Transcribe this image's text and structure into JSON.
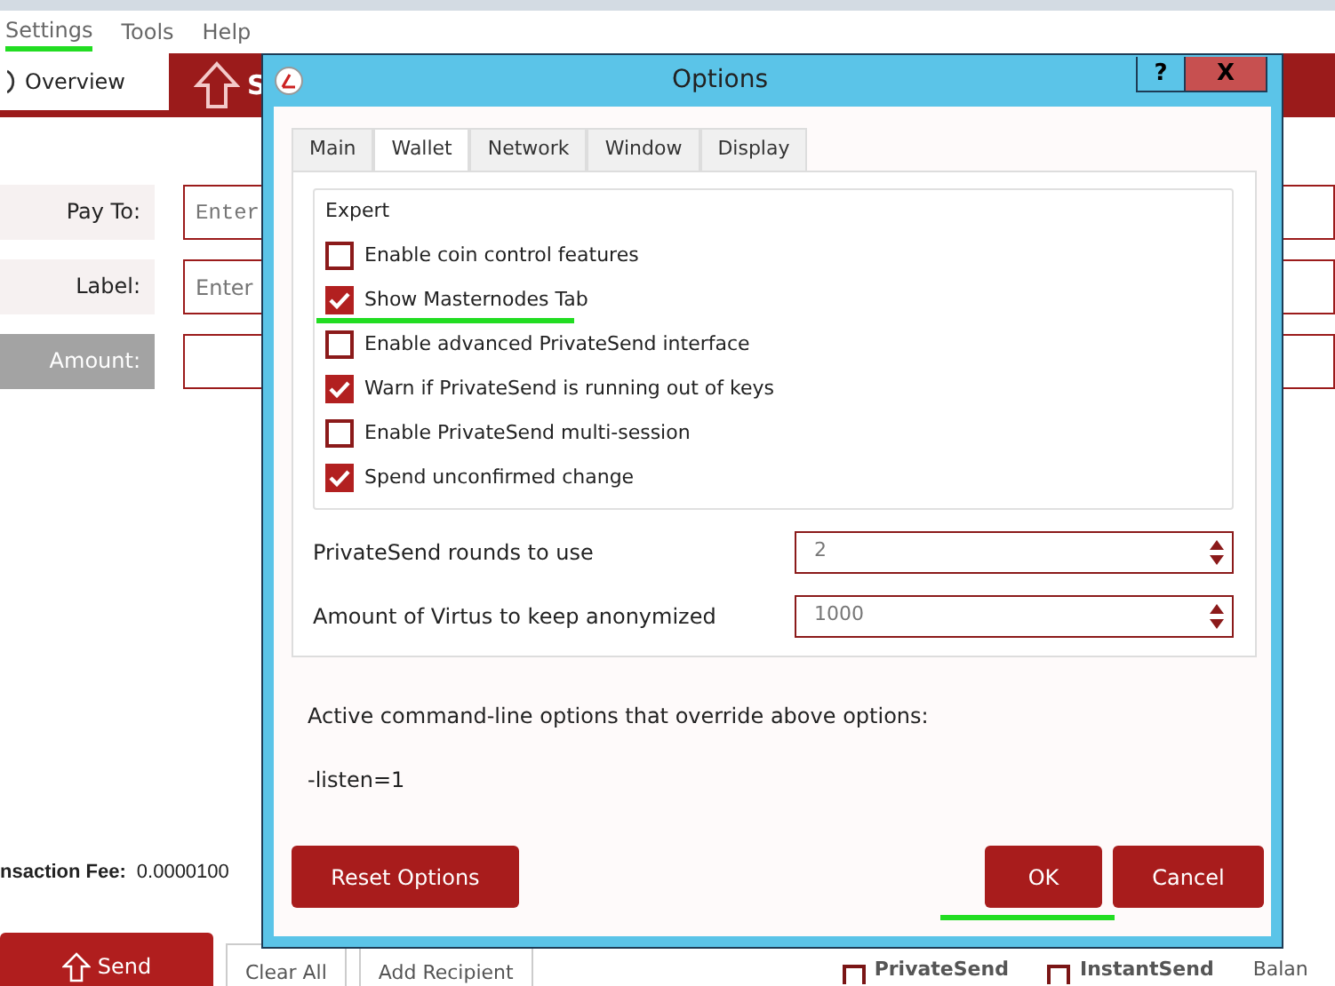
{
  "menu": [
    {
      "label": "Settings",
      "highlighted": true
    },
    {
      "label": "Tools",
      "highlighted": false
    },
    {
      "label": "Help",
      "highlighted": false
    }
  ],
  "toolbar": [
    {
      "label": "Overview",
      "selected": false
    },
    {
      "label": "S",
      "selected": true
    }
  ],
  "send_form": {
    "fields": [
      {
        "label": "Pay To:",
        "placeholder": "Enter",
        "kind": "address"
      },
      {
        "label": "Label:",
        "placeholder": "Enter",
        "kind": "text"
      },
      {
        "label": "Amount:",
        "kind": "amount"
      }
    ]
  },
  "fee": {
    "label": "nsaction Fee:",
    "value": "0.0000100"
  },
  "bottom_bar": {
    "buttons": [
      {
        "label": "Send",
        "kind": "primary"
      },
      {
        "label": "Clear All",
        "kind": "secondary"
      },
      {
        "label": "Add Recipient",
        "kind": "secondary"
      }
    ],
    "options": [
      {
        "label": "PrivateSend",
        "checked": false
      },
      {
        "label": "InstantSend",
        "checked": false
      }
    ],
    "balance_label": "Balan"
  },
  "dialog": {
    "title": "Options",
    "help_button": "?",
    "close_button": "X",
    "tabs": [
      {
        "label": "Main",
        "selected": false
      },
      {
        "label": "Wallet",
        "selected": true
      },
      {
        "label": "Network",
        "selected": false
      },
      {
        "label": "Window",
        "selected": false
      },
      {
        "label": "Display",
        "selected": false
      }
    ],
    "group_title": "Expert",
    "checkboxes": [
      {
        "label": "Enable coin control features",
        "checked": false,
        "highlighted": false
      },
      {
        "label": "Show Masternodes Tab",
        "checked": true,
        "highlighted": true
      },
      {
        "label": "Enable advanced PrivateSend interface",
        "checked": false,
        "highlighted": false
      },
      {
        "label": "Warn if PrivateSend is running out of keys",
        "checked": true,
        "highlighted": false
      },
      {
        "label": "Enable PrivateSend multi-session",
        "checked": false,
        "highlighted": false
      },
      {
        "label": "Spend unconfirmed change",
        "checked": true,
        "highlighted": false
      }
    ],
    "spinboxes": [
      {
        "label": "PrivateSend rounds to use",
        "value": "2"
      },
      {
        "label": "Amount of Virtus to keep anonymized",
        "value": "1000"
      }
    ],
    "override_note": "Active command-line options that override above options:",
    "override_value": "-listen=1",
    "buttons": [
      {
        "label": "Reset Options",
        "kind": "reset",
        "highlighted": false
      },
      {
        "label": "OK",
        "kind": "ok",
        "highlighted": true
      },
      {
        "label": "Cancel",
        "kind": "cancel",
        "highlighted": false
      }
    ]
  }
}
